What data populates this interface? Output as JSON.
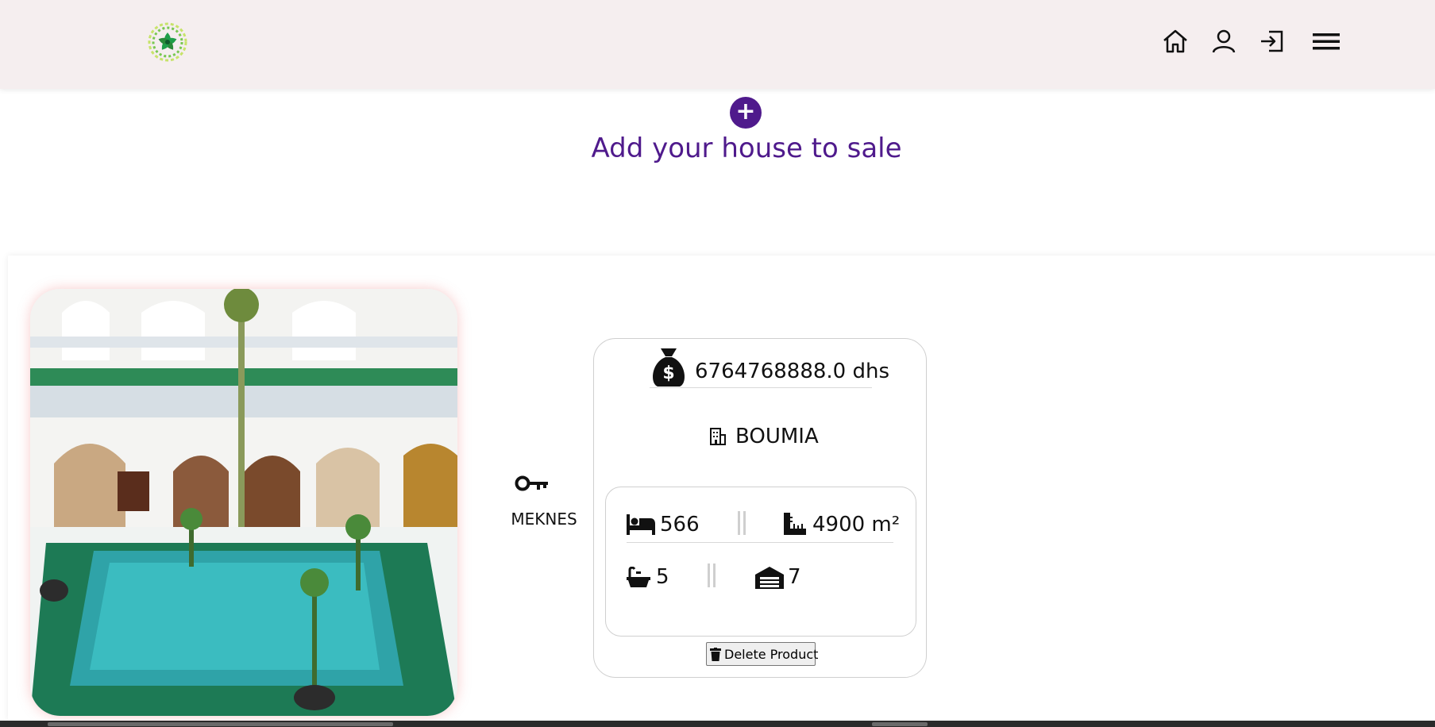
{
  "header": {
    "logo_icon": "flower-logo-icon",
    "nav_icons": [
      "home-icon",
      "user-icon",
      "login-icon",
      "hamburger-menu-icon"
    ]
  },
  "add_house": {
    "button_symbol": "+",
    "title": "Add your house to sale"
  },
  "listing": {
    "photo_icon": "riad-courtyard-pool-photo",
    "city_icon": "key-icon",
    "city": "MEKNES",
    "price": "6764768888.0 dhs",
    "neighborhood": "BOUMIA",
    "bedrooms": "566",
    "area": "4900 m²",
    "bathrooms": "5",
    "garages": "7",
    "delete_label": "Delete Product"
  },
  "colors": {
    "accent": "#4f1a8c",
    "navbar_bg": "#f5eeef"
  }
}
